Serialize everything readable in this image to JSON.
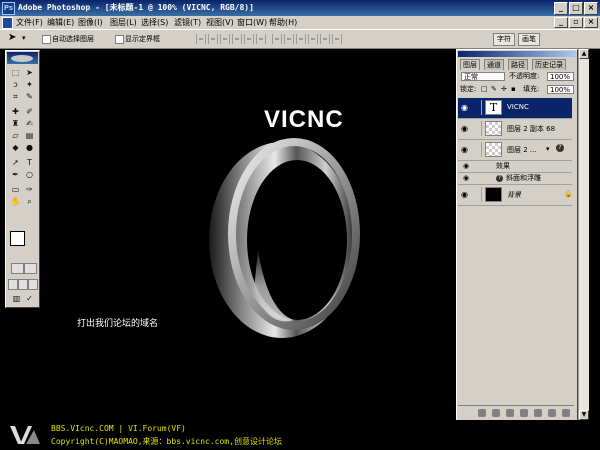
{
  "window": {
    "title": "Adobe Photoshop - [未标题-1 @ 100% (VICNC, RGB/8)]",
    "app_icon_label": "Ps"
  },
  "menu": [
    "文件(F)",
    "编辑(E)",
    "图像(I)",
    "图层(L)",
    "选择(S)",
    "滤镜(T)",
    "视图(V)",
    "窗口(W)",
    "帮助(H)"
  ],
  "options": {
    "auto_select_layer": "自动选择图层",
    "show_bounding_box": "显示定界框",
    "tab_fonts": "字符",
    "tab_brushes": "画笔"
  },
  "canvas": {
    "title_text": "VICNC",
    "caption": "打出我们论坛的域名"
  },
  "layers_panel": {
    "tabs": [
      "图层",
      "通道",
      "路径",
      "历史记录"
    ],
    "blend_mode": "正常",
    "opacity_label": "不透明度:",
    "opacity_value": "100%",
    "lock_label": "锁定:",
    "fill_label": "填充:",
    "fill_value": "100%",
    "layers": [
      {
        "name": "VICNC",
        "type": "text",
        "selected": true
      },
      {
        "name": "图层 2 副本 68",
        "type": "raster",
        "selected": false
      },
      {
        "name": "图层 2 ...",
        "type": "raster-fx",
        "selected": false
      },
      {
        "name": "背景",
        "type": "background",
        "selected": false
      }
    ],
    "effects_label": "效果",
    "effect_item": "斜面和浮雕"
  },
  "footer": {
    "line1": "BBS.VIcnc.COM | VI.Forum(VF)",
    "line2": "Copyright(C)MAOMAO,来源：bbs.vicnc.com,创意设计论坛"
  },
  "colors": {
    "titlebar": "#0a246a",
    "chrome": "#d4d0c8",
    "canvas": "#000000",
    "footer_text": "#e0e000"
  }
}
